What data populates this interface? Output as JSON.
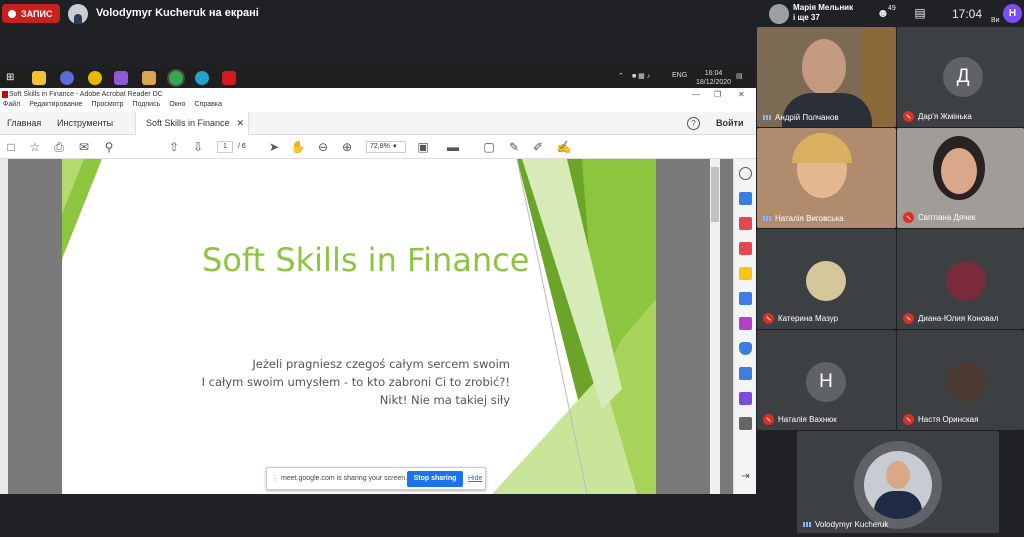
{
  "meet": {
    "recording_label": "ЗАПИС",
    "presenter_label": "Volodymyr Kucheruk на екрані",
    "participants_top": "Марія Мельник",
    "participants_more": "і ще 37",
    "people_count": "49",
    "clock": "17:04",
    "self_initial": "Н",
    "self_label": "Ви"
  },
  "screen": {
    "taskbar": {
      "lang": "ENG",
      "time": "16:04",
      "date": "18/12/2020"
    },
    "window_title": "Soft Skills in Finance - Adobe Acrobat Reader DC",
    "menu": [
      "Файл",
      "Редактирование",
      "Просмотр",
      "Подпись",
      "Окно",
      "Справка"
    ],
    "tabs": {
      "home": "Главная",
      "tools": "Инструменты",
      "doc": "Soft Skills in Finance"
    },
    "help": "?",
    "login": "Войти",
    "page_current": "1",
    "page_total": "/ 6",
    "zoom": "72,8%",
    "slide": {
      "title": "Soft Skills in Finance",
      "quote1": "Jeżeli pragniesz czegoś całym sercem swoim",
      "quote2": "I całym swoim umysłem - to kto zabroni Ci to zrobić?!",
      "quote3": "Nikt! Nie ma takiej siły"
    },
    "share": {
      "text": "meet.google.com is sharing your screen.",
      "stop": "Stop sharing",
      "hide": "Hide"
    }
  },
  "tiles": [
    {
      "name": "Андрій Полчанов"
    },
    {
      "name": "Дар'я Жмінька",
      "initial": "Д"
    },
    {
      "name": "Наталія Виговська"
    },
    {
      "name": "Світлана Дячек"
    },
    {
      "name": "Катерина Мазур"
    },
    {
      "name": "Диана-Юлия Коновал"
    },
    {
      "name": "Наталія Вахнюк",
      "initial": "Н"
    },
    {
      "name": "Настя Оринская"
    },
    {
      "name": "Volodymyr Kucheruk"
    }
  ],
  "colors": {
    "accent_green": "#8cc63f",
    "record_red": "#c5221f",
    "meet_blue": "#1a73e8",
    "self_purple": "#7c4dff"
  }
}
